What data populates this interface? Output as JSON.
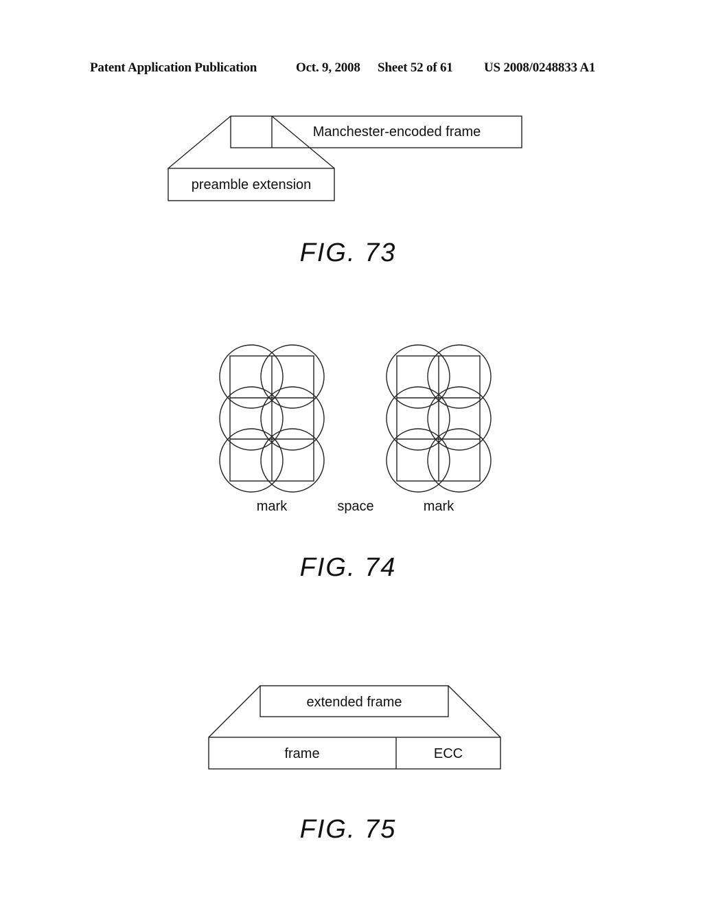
{
  "header": {
    "publication": "Patent Application Publication",
    "date": "Oct. 9, 2008",
    "sheet": "Sheet 52 of 61",
    "number": "US 2008/0248833 A1"
  },
  "fig73": {
    "caption": "FIG. 73",
    "frame_label": "Manchester-encoded frame",
    "extension_label": "preamble extension"
  },
  "fig74": {
    "caption": "FIG. 74",
    "labels": [
      "mark",
      "space",
      "mark"
    ]
  },
  "fig75": {
    "caption": "FIG. 75",
    "top_label": "extended frame",
    "frame_label": "frame",
    "ecc_label": "ECC"
  }
}
